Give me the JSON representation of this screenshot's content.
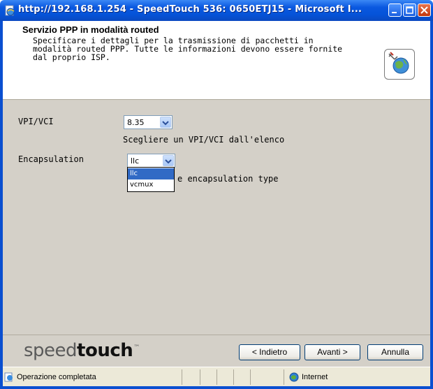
{
  "window": {
    "title": "http://192.168.1.254 - SpeedTouch 536:  0650ETJ15 - Microsoft I..."
  },
  "header": {
    "title": "Servizio PPP in modalità routed",
    "description": "Specificare i dettagli per la trasmissione di pacchetti in modalità routed PPP. Tutte le informazioni devono essere fornite dal proprio ISP.",
    "icon": "network-globe-icon"
  },
  "form": {
    "vpi_label": "VPI/VCI",
    "vpi_value": "8.35",
    "vpi_hint": "Scegliere un VPI/VCI dall'elenco",
    "encap_label": "Encapsulation",
    "encap_value": "llc",
    "encap_hint": "e encapsulation type",
    "encap_options": [
      "llc",
      "vcmux"
    ]
  },
  "footer": {
    "logo_light": "speed",
    "logo_bold": "touch",
    "logo_tm": "™",
    "back_label": "< Indietro",
    "next_label": "Avanti >",
    "cancel_label": "Annulla"
  },
  "statusbar": {
    "status": "Operazione completata",
    "zone": "Internet"
  },
  "colors": {
    "titlebar": "#0553d8",
    "body_bg": "#d4d0c8",
    "selection": "#316ac5"
  }
}
